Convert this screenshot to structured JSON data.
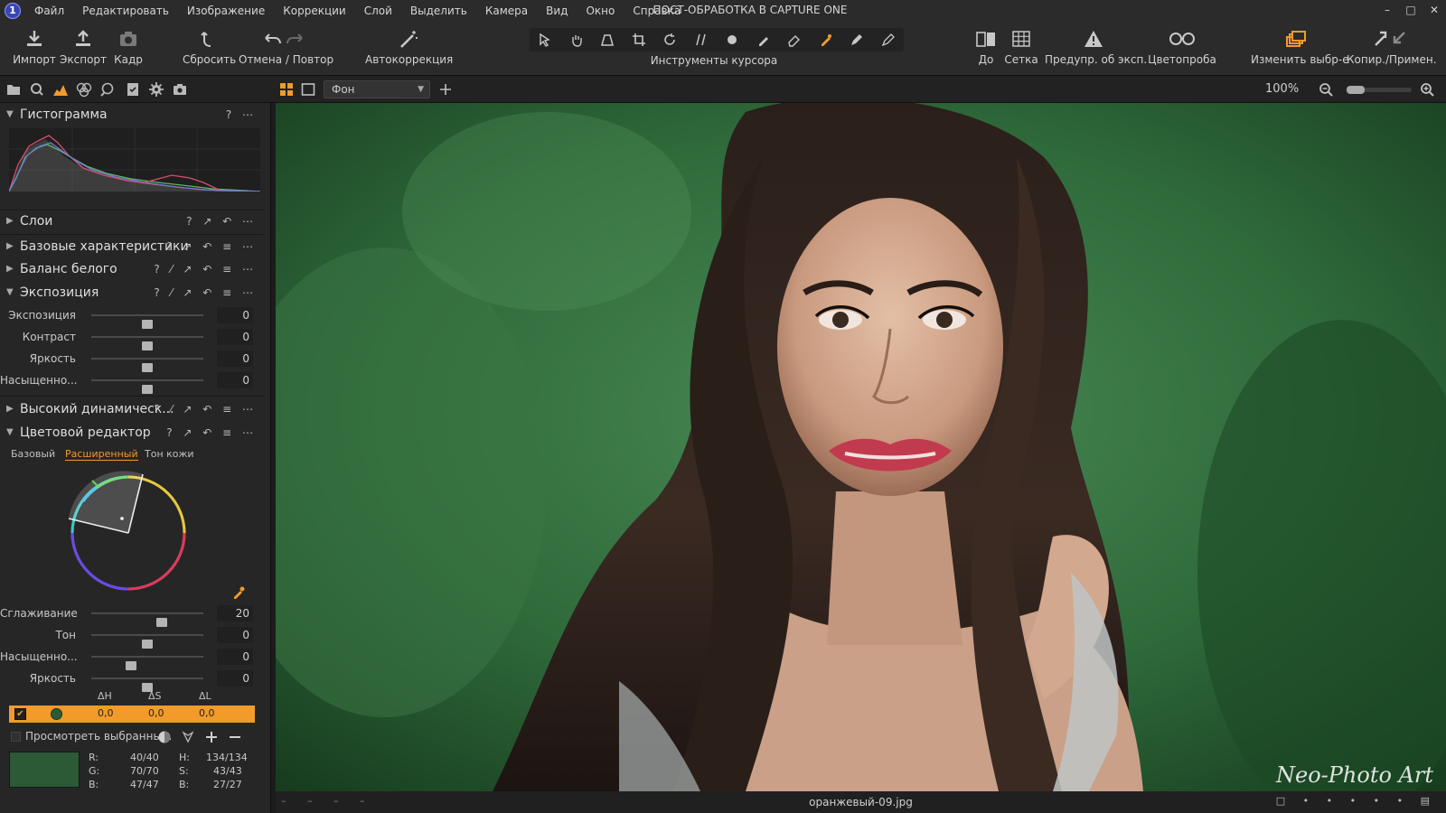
{
  "app": {
    "window_title": "ПОСТ-ОБРАБОТКА В CAPTURE ONE",
    "menus": [
      "Файл",
      "Редактировать",
      "Изображение",
      "Коррекции",
      "Слой",
      "Выделить",
      "Камера",
      "Вид",
      "Окно",
      "Справка"
    ],
    "window_controls": {
      "minimize": "–",
      "maximize": "□",
      "close": "✕"
    }
  },
  "toolbar": {
    "import": "Импорт",
    "export": "Экспорт",
    "frame": "Кадр",
    "reset": "Сбросить",
    "undo_redo": "Отмена / Повтор",
    "auto_adjust": "Автокоррекция",
    "cursor_tools": "Инструменты курсора",
    "before": "До",
    "grid": "Сетка",
    "exposure_warning": "Предупр. об эксп.",
    "color_proof": "Цветопроба",
    "edit_selected": "Изменить выбр-е",
    "copy_apply": "Копир./Примен."
  },
  "viewer_bar": {
    "dropdown_value": "Фон",
    "zoom": "100%"
  },
  "panels": {
    "histogram": "Гистограмма",
    "layers": "Слои",
    "base_characteristics": "Базовые характеристики",
    "white_balance": "Баланс белого",
    "exposure": "Экспозиция",
    "hdr": "Высокий динамическ...",
    "color_editor": "Цветовой редактор"
  },
  "exposure_sliders": [
    {
      "label": "Экспозиция",
      "value": "0"
    },
    {
      "label": "Контраст",
      "value": "0"
    },
    {
      "label": "Яркость",
      "value": "0"
    },
    {
      "label": "Насыщенно...",
      "value": "0"
    }
  ],
  "color_editor": {
    "tabs": [
      "Базовый",
      "Расширенный",
      "Тон кожи"
    ],
    "active_tab": "Расширенный",
    "sliders": [
      {
        "label": "Сглаживание",
        "value": "20"
      },
      {
        "label": "Тон",
        "value": "0"
      },
      {
        "label": "Насыщенно...",
        "value": "0"
      },
      {
        "label": "Яркость",
        "value": "0"
      }
    ],
    "table_headers": [
      "ΔH",
      "ΔS",
      "ΔL"
    ],
    "row": {
      "dh": "0,0",
      "ds": "0,0",
      "dl": "0,0",
      "color": "#2c5a36"
    },
    "view_selected": "Просмотреть выбранны...",
    "readout": {
      "r_label": "R:",
      "r": "40/40",
      "g_label": "G:",
      "g": "70/70",
      "b_label": "B:",
      "b": "47/47",
      "h_label": "H:",
      "h": "134/134",
      "s_label": "S:",
      "s": "43/43",
      "b2_label": "B:",
      "b2": "27/27"
    }
  },
  "viewer": {
    "filename": "оранжевый-09.jpg",
    "watermark": "Neo-Photo Art"
  },
  "colors": {
    "accent": "#f29b2a",
    "panel_bg": "#262626",
    "photo_bg": "#2f5c34"
  }
}
